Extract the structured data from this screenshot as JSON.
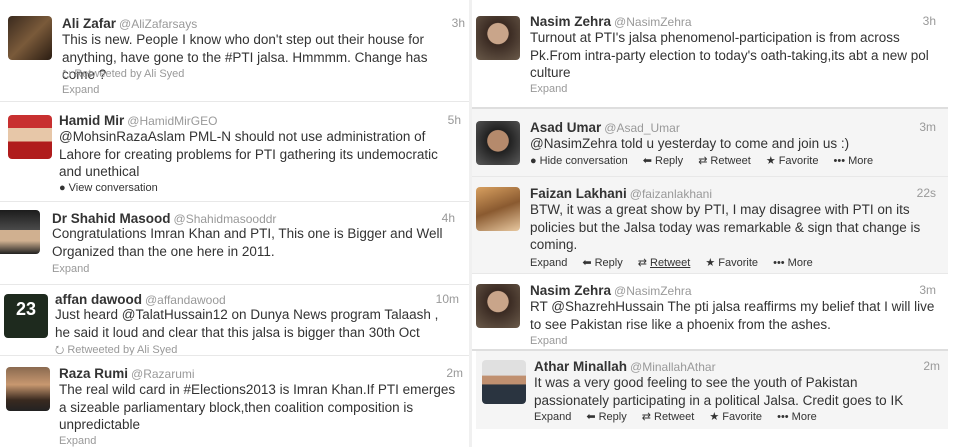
{
  "left": [
    {
      "name": "Ali Zafar",
      "handle": "@AliZafarsays",
      "time": "3h",
      "text": "This is new. People I know who don't step out their house for anything, have gone to the #PTI jalsa. Hmmmm. Change has come ?",
      "retweet": "Retweeted by Ali Syed",
      "expand": "Expand"
    },
    {
      "name": "Hamid Mir",
      "handle": "@HamidMirGEO",
      "time": "5h",
      "text": "@MohsinRazaAslam PML-N should not use administration of Lahore for creating problems for PTI gathering its undemocratic and unethical",
      "conversation": "View conversation"
    },
    {
      "name": "Dr Shahid Masood",
      "handle": "@Shahidmasooddr",
      "time": "4h",
      "text": "Congratulations Imran Khan and PTI, This one is Bigger and Well Organized than the one here in 2011.",
      "expand": "Expand"
    },
    {
      "name": "affan dawood",
      "handle": "@affandawood",
      "time": "10m",
      "text": "Just heard @TalatHussain12 on Dunya News program Talaash , he said it loud and clear that this jalsa is bigger than 30th Oct",
      "retweet": "Retweeted by Ali Syed",
      "avatar_text": "23"
    },
    {
      "name": "Raza Rumi",
      "handle": "@Razarumi",
      "time": "2m",
      "text": "The real wild card in #Elections2013 is Imran Khan.If PTI emerges a sizeable parliamentary block,then coalition composition is unpredictable",
      "expand": "Expand"
    }
  ],
  "right": [
    {
      "name": "Nasim Zehra",
      "handle": "@NasimZehra",
      "time": "3h",
      "text": "Turnout at PTI's jalsa phenomenol-participation is from across Pk.From intra-party election to today's oath-taking,its abt a new pol culture",
      "expand": "Expand"
    },
    {
      "name": "Asad Umar",
      "handle": "@Asad_Umar",
      "time": "3m",
      "text": "@NasimZehra told u yesterday to come and join us :)",
      "actions": [
        "Hide conversation",
        "Reply",
        "Retweet",
        "Favorite",
        "More"
      ]
    },
    {
      "name": "Faizan Lakhani",
      "handle": "@faizanlakhani",
      "time": "22s",
      "text": "BTW, it was a great show by PTI, I may disagree with PTI on its policies but the Jalsa today was remarkable & sign that change is coming.",
      "actions": [
        "Expand",
        "Reply",
        "Retweet",
        "Favorite",
        "More"
      ]
    },
    {
      "name": "Nasim Zehra",
      "handle": "@NasimZehra",
      "time": "3m",
      "text": "RT @ShazrehHussain The pti jalsa reaffirms my belief that I will live to see Pakistan rise like a phoenix from the ashes.",
      "expand": "Expand"
    },
    {
      "name": "Athar Minallah",
      "handle": "@MinallahAthar",
      "time": "2m",
      "text": "It was a very good feeling to see the youth of Pakistan passionately participating in a political Jalsa. Credit goes to IK",
      "actions": [
        "Expand",
        "Reply",
        "Retweet",
        "Favorite",
        "More"
      ]
    }
  ]
}
